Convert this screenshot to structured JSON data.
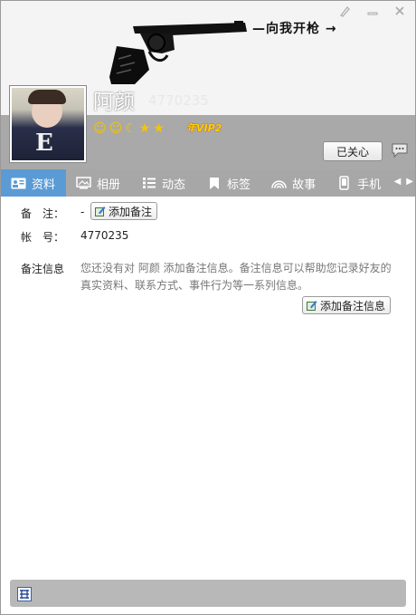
{
  "window": {
    "controls": [
      {
        "name": "skin-icon",
        "glyph": "🖌"
      },
      {
        "name": "minimize-icon",
        "glyph": "—"
      },
      {
        "name": "close-icon",
        "glyph": "✕"
      }
    ]
  },
  "header": {
    "slogan": "—向我开枪 →",
    "nickname": "阿颜",
    "account": "4770235",
    "level_icons": [
      "☺",
      "☺",
      "☾",
      "★",
      "★"
    ],
    "vip_badge": "年VIP2",
    "follow_label": "已关心"
  },
  "tabs": [
    {
      "label": "资料",
      "icon": "profile-card-icon",
      "active": true
    },
    {
      "label": "相册",
      "icon": "album-icon",
      "active": false
    },
    {
      "label": "动态",
      "icon": "feed-icon",
      "active": false
    },
    {
      "label": "标签",
      "icon": "tag-icon",
      "active": false
    },
    {
      "label": "故事",
      "icon": "story-icon",
      "active": false
    },
    {
      "label": "手机",
      "icon": "phone-icon",
      "active": false
    }
  ],
  "info": {
    "remark_label": "备　注：",
    "remark_value": "-",
    "add_remark_button": "添加备注",
    "account_label": "帐　号：",
    "account_value": "4770235",
    "remark_info_label": "备注信息",
    "remark_info_desc": "您还没有对 阿颜 添加备注信息。备注信息可以帮助您记录好友的真实资料、联系方式、事件行为等一系列信息。",
    "add_remark_info_button": "添加备注信息"
  },
  "colors": {
    "active_tab": "#5b9bd5",
    "tab_bar": "#a7a7a7",
    "header_band": "#a9a9a9"
  }
}
